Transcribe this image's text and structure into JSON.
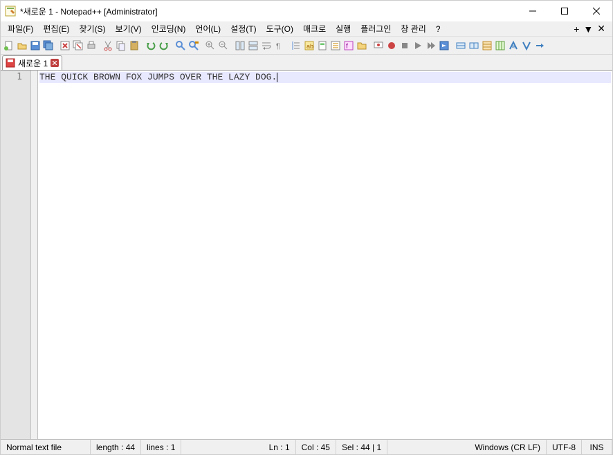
{
  "window": {
    "title": "*새로운 1 - Notepad++ [Administrator]"
  },
  "menu": {
    "items": [
      "파일(F)",
      "편집(E)",
      "찾기(S)",
      "보기(V)",
      "인코딩(N)",
      "언어(L)",
      "설정(T)",
      "도구(O)",
      "매크로",
      "실행",
      "플러그인",
      "창 관리",
      "?"
    ]
  },
  "tab": {
    "label": "새로운 1"
  },
  "editor": {
    "line_number": "1",
    "content": "THE QUICK BROWN FOX JUMPS OVER THE LAZY DOG."
  },
  "status": {
    "filetype": "Normal text file",
    "length": "length : 44",
    "lines": "lines : 1",
    "ln": "Ln : 1",
    "col": "Col : 45",
    "sel": "Sel : 44 | 1",
    "eol": "Windows (CR LF)",
    "encoding": "UTF-8",
    "mode": "INS"
  }
}
